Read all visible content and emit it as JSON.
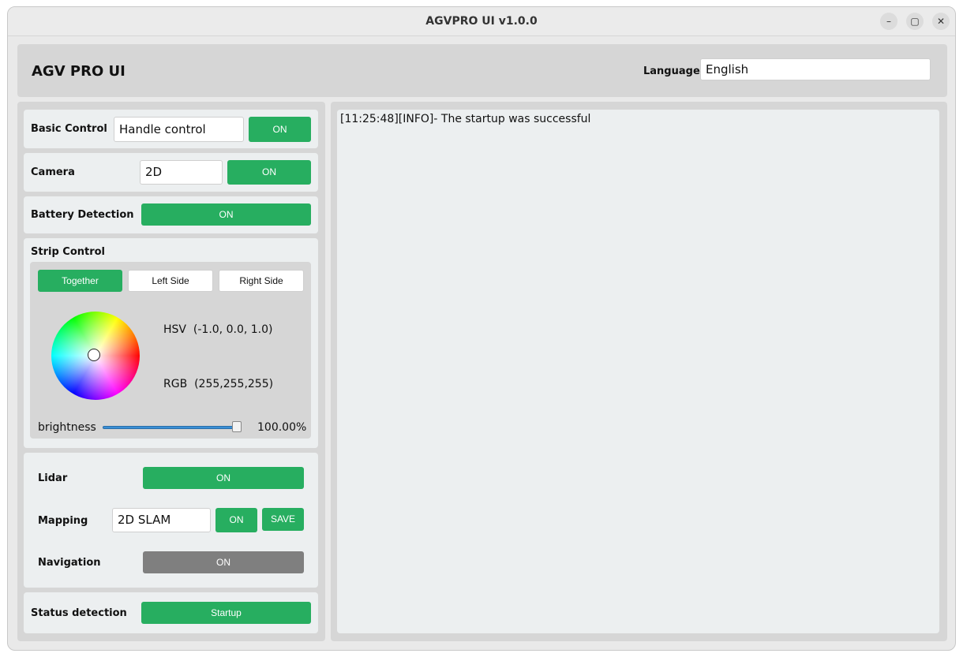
{
  "window": {
    "title": "AGVPRO UI v1.0.0",
    "controls": [
      "minimize",
      "maximize",
      "close"
    ]
  },
  "header": {
    "app_title": "AGV PRO UI",
    "language_label": "Language",
    "language_value": "English"
  },
  "basic_control": {
    "label": "Basic Control",
    "mode_value": "Handle control",
    "button": "ON"
  },
  "camera": {
    "label": "Camera",
    "mode_value": "2D",
    "button": "ON"
  },
  "battery": {
    "label": "Battery Detection",
    "button": "ON"
  },
  "strip": {
    "label": "Strip Control",
    "tabs": [
      "Together",
      "Left Side",
      "Right Side"
    ],
    "selected_tab": "Together",
    "hsv_label": "HSV",
    "hsv_value": "(-1.0, 0.0, 1.0)",
    "rgb_label": "RGB",
    "rgb_value": "(255,255,255)",
    "brightness_label": "brightness",
    "brightness_text": "100.00%",
    "brightness_fraction": 1.0
  },
  "lidar": {
    "label": "Lidar",
    "button": "ON"
  },
  "mapping": {
    "label": "Mapping",
    "mode_value": "2D SLAM",
    "button": "ON",
    "save_button": "SAVE"
  },
  "navigation": {
    "label": "Navigation",
    "button": "ON"
  },
  "status": {
    "label": "Status detection",
    "button": "Startup"
  },
  "log": {
    "lines": [
      "[11:25:48][INFO]- The startup was successful"
    ]
  },
  "colors": {
    "accent_green": "#27ae60",
    "disabled_gray": "#7f7f7f",
    "panel_bg": "#eceff0",
    "frame_bg": "#d6d6d6"
  }
}
